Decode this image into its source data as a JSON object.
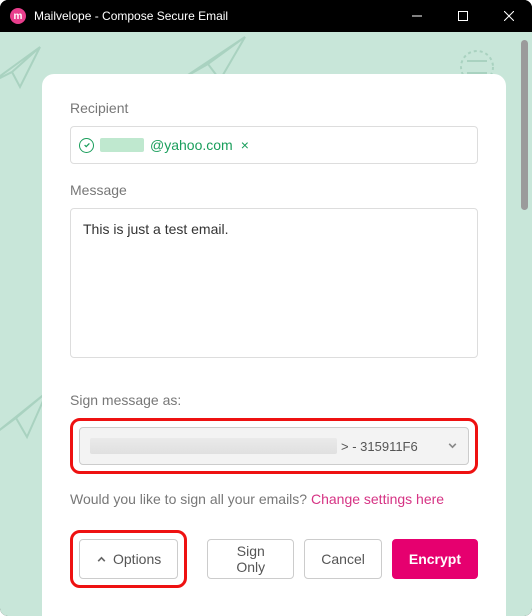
{
  "window": {
    "title": "Mailvelope - Compose Secure Email"
  },
  "compose": {
    "recipient_label": "Recipient",
    "recipient_domain": "@yahoo.com",
    "recipient_remove": "×",
    "message_label": "Message",
    "message_value": "This is just a test email."
  },
  "sign": {
    "label": "Sign message as:",
    "selected_tail": "> - 315911F6",
    "hint_prefix": "Would you like to sign all your emails? ",
    "hint_link": "Change settings here"
  },
  "buttons": {
    "options": "Options",
    "sign_only": "Sign Only",
    "cancel": "Cancel",
    "encrypt": "Encrypt"
  }
}
